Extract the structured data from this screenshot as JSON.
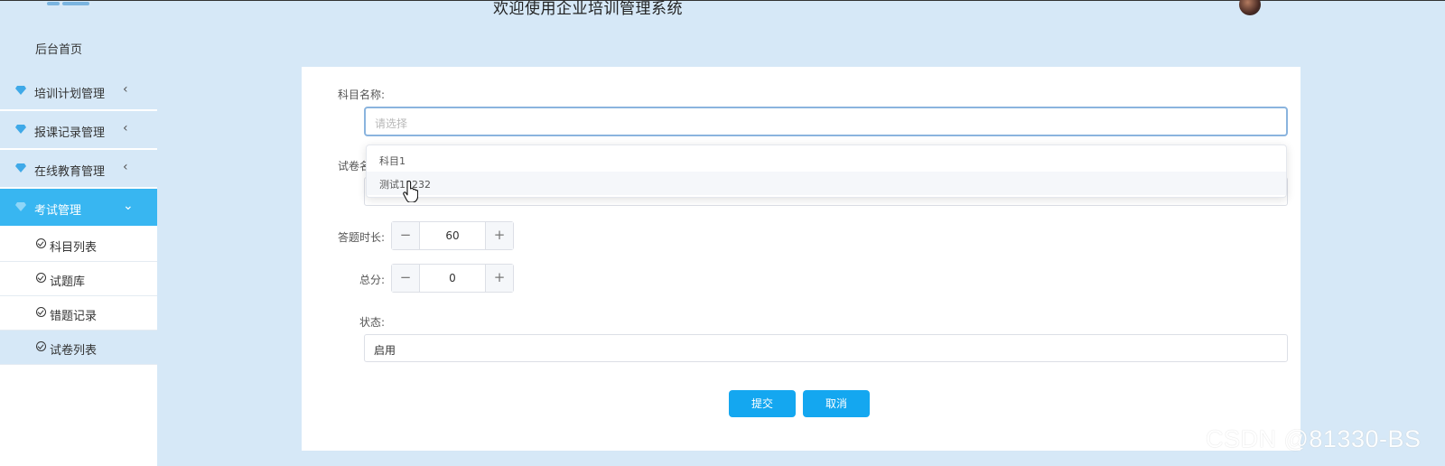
{
  "header": {
    "title": "欢迎使用企业培训管理系统"
  },
  "sidebar": {
    "home": "后台首页",
    "groups": [
      {
        "label": "培训计划管理",
        "chevron": "‹"
      },
      {
        "label": "报课记录管理",
        "chevron": "‹"
      },
      {
        "label": "在线教育管理",
        "chevron": "‹"
      },
      {
        "label": "考试管理",
        "chevron": "⌄"
      }
    ],
    "sub_items": [
      {
        "label": "科目列表"
      },
      {
        "label": "试题库"
      },
      {
        "label": "错题记录"
      },
      {
        "label": "试卷列表"
      }
    ]
  },
  "form": {
    "subject_label": "科目名称:",
    "subject_placeholder": "请选择",
    "paper_label": "试卷名",
    "duration_label": "答题时长:",
    "duration_value": "60",
    "score_label": "总分:",
    "score_value": "0",
    "status_label": "状态:",
    "status_value": "启用",
    "minus": "−",
    "plus": "+"
  },
  "dropdown": {
    "options": [
      {
        "label": "科目1"
      },
      {
        "label": "测试11232"
      }
    ]
  },
  "actions": {
    "submit": "提交",
    "cancel": "取消"
  },
  "watermark": "CSDN @81330-BS",
  "colors": {
    "accent": "#38b6f1",
    "button": "#14a7f0",
    "background": "#d6e8f7"
  }
}
